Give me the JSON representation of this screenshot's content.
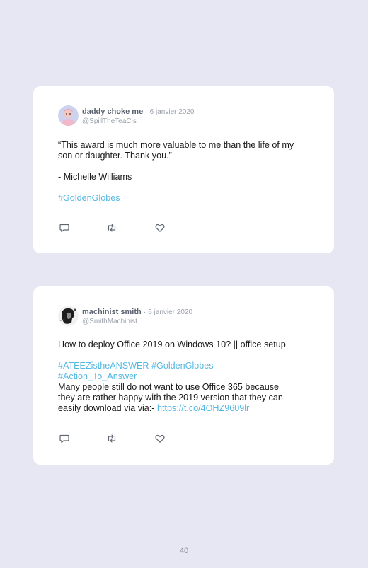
{
  "tweets": [
    {
      "name": "daddy choke me",
      "separator": "·",
      "date": "6 janvier 2020",
      "handle": "@SpillTheTeaCis",
      "line1": "“This award is much more valuable to me than the life of my",
      "line2": "son or daughter. Thank you.”",
      "line3": "- Michelle Williams",
      "hashtag": "#GoldenGlobes"
    },
    {
      "name": "machinist smith",
      "separator": "·",
      "date": "6 janvier 2020",
      "handle": "@SmithMachinist",
      "line1": "How to deploy Office 2019 on Windows 10? || office setup",
      "hashtag1": "#ATEEZistheANSWER",
      "hashtag2": "#GoldenGlobes",
      "hashtag3": "#Action_To_Answer",
      "line2": "Many people still do not want to use Office 365 because",
      "line3": "they are rather happy with the 2019 version that they can",
      "line4": "easily download via via:-",
      "link": "https://t.co/4OHZ9609lr"
    }
  ],
  "page_number": "40",
  "icons": [
    "reply-icon",
    "retweet-icon",
    "like-icon"
  ],
  "colors": {
    "background": "#e6e7f3",
    "card": "#ffffff",
    "link": "#55b8e2",
    "muted": "#9aa0ab"
  }
}
